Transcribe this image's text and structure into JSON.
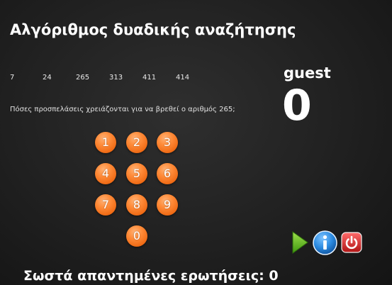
{
  "title": "Αλγόριθμος δυαδικής αναζήτησης",
  "sequence": [
    "7",
    "24",
    "265",
    "313",
    "411",
    "414"
  ],
  "question": "Πόσες προσπελάσεις χρειάζονται για να βρεθεί ο αριθμός 265;",
  "player": {
    "name": "guest",
    "score": "0"
  },
  "keypad": {
    "keys": [
      "1",
      "2",
      "3",
      "4",
      "5",
      "6",
      "7",
      "8",
      "9",
      "0"
    ],
    "color": "#ef6a14"
  },
  "controls": {
    "play_icon": "play-icon",
    "info_icon": "info-icon",
    "power_icon": "power-icon",
    "play_color": "#5dbb1e",
    "info_color": "#1b78c8",
    "power_color": "#d21f1f"
  },
  "status": {
    "correct_answers": "Σωστά απαντημένες ερωτήσεις: 0"
  }
}
